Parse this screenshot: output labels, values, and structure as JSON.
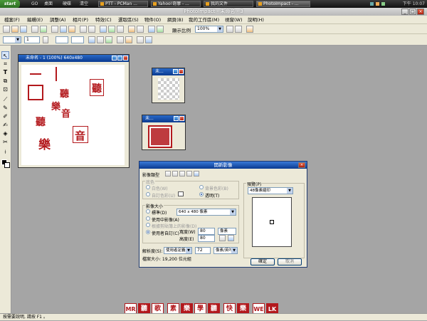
{
  "taskbar": {
    "start_label": "start",
    "quick_launch": [
      "GO",
      "桌面",
      "硬碟",
      "清空"
    ],
    "buttons": [
      {
        "label": "PTT - PCMan ..."
      },
      {
        "label": "Yahoo!奇摩 - ..."
      },
      {
        "label": "我的文件"
      },
      {
        "label": "PhotoImpact - ..."
      }
    ],
    "clock": "下午 10:07"
  },
  "app": {
    "title": "PhotoImpact - 未命名 - 3",
    "win_buttons": [
      "_",
      "□",
      "×"
    ]
  },
  "menu": {
    "items": [
      "檔案(F)",
      "編輯(E)",
      "調整(A)",
      "相片(P)",
      "特效(C)",
      "選取區(S)",
      "物件(O)",
      "網頁(B)",
      "我的工作區(M)",
      "視窗(W)",
      "說明(H)"
    ]
  },
  "toolbar": {
    "zoom_label": "顯示比例",
    "zoom_value": "100%",
    "row2_spin_value": "1"
  },
  "palette": {
    "tools": [
      "arrow-tool",
      "crop-tool",
      "text-tool",
      "transform-tool",
      "select-tool",
      "line-tool",
      "paint-tool",
      "clone-tool",
      "retouch-tool",
      "fill-tool",
      "eraser-tool",
      "eyedropper-tool"
    ]
  },
  "doc_main": {
    "title": "未命名 - 1 (100%) 640x480",
    "seals": [
      "聽",
      "樂",
      "音",
      "聽",
      "聽",
      "樂",
      "音"
    ]
  },
  "doc_small1": {
    "title": "未..."
  },
  "doc_small2": {
    "title": "未..."
  },
  "dialog": {
    "title": "開新影像",
    "image_type_label": "影像類型",
    "bg_group": "底色",
    "bg_white": "白色(W)",
    "bg_custom": "自訂色彩(U)",
    "bg_background": "背景色彩(B)",
    "bg_transparent": "透明(T)",
    "size_group": "影像大小",
    "size_standard": "標準(D)",
    "size_standard_value": "640 x 480 像素",
    "size_current": "使用中影像(A)",
    "size_clipboard": "根據剪貼簿上的影像(D)",
    "size_custom": "使用者自訂(C)",
    "width_label": "寬度(W)",
    "width_value": "80",
    "height_label": "高度(E)",
    "height_value": "80",
    "unit_value": "像素",
    "resolution_label": "解析度(S):",
    "resolution_mode": "使用者定義",
    "resolution_value": "72",
    "resolution_unit": "像素/英吋",
    "preview_label": "預覽(P)",
    "preview_combo": "48像素縮印",
    "filesize": "檔案大小: 19,200 位元組",
    "ok": "確定",
    "cancel": "取消"
  },
  "stamps": [
    "MR",
    "聽",
    "歌",
    "素",
    "樂",
    "學",
    "聽",
    "快",
    "樂",
    "WE",
    "LK"
  ],
  "status": {
    "text": "按需要說明, 請按 F1 。"
  }
}
